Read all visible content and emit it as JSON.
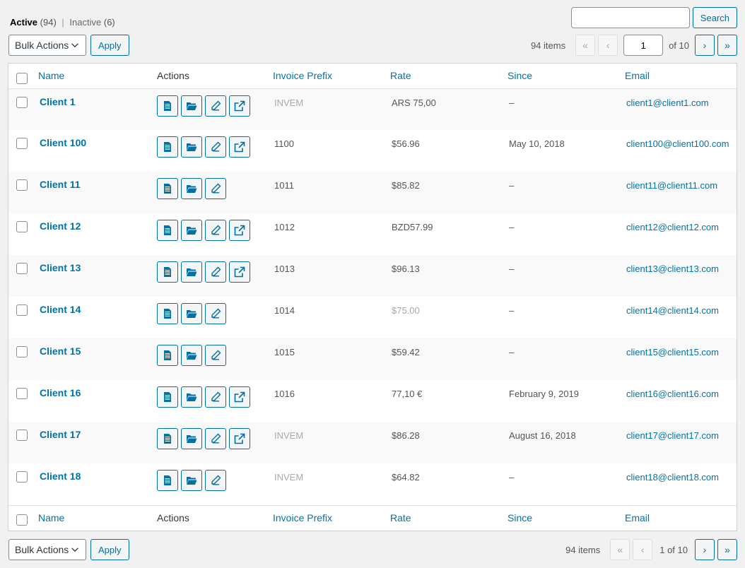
{
  "filters": {
    "active_label": "Active",
    "active_count": "(94)",
    "separator": "|",
    "inactive_label": "Inactive",
    "inactive_count": "(6)"
  },
  "search": {
    "placeholder": "",
    "button": "Search"
  },
  "bulk": {
    "label": "Bulk Actions",
    "apply": "Apply"
  },
  "pagination_top": {
    "items": "94 items",
    "first": "«",
    "prev": "‹",
    "current_page": "1",
    "of_label": "of 10",
    "next": "›",
    "last": "»"
  },
  "pagination_bottom": {
    "items": "94 items",
    "first": "«",
    "prev": "‹",
    "page_text": "1 of 10",
    "next": "›",
    "last": "»"
  },
  "columns": {
    "name": "Name",
    "actions": "Actions",
    "prefix": "Invoice Prefix",
    "rate": "Rate",
    "since": "Since",
    "email": "Email"
  },
  "rows": [
    {
      "name": "Client 1",
      "prefix": "INVEM",
      "prefix_muted": true,
      "rate": "ARS 75,00",
      "rate_muted": false,
      "since": "–",
      "email": "client1@client1.com",
      "external": true
    },
    {
      "name": "Client 100",
      "prefix": "1100",
      "prefix_muted": false,
      "rate": "$56.96",
      "rate_muted": false,
      "since": "May 10, 2018",
      "email": "client100@client100.com",
      "external": true
    },
    {
      "name": "Client 11",
      "prefix": "1011",
      "prefix_muted": false,
      "rate": "$85.82",
      "rate_muted": false,
      "since": "–",
      "email": "client11@client11.com",
      "external": false
    },
    {
      "name": "Client 12",
      "prefix": "1012",
      "prefix_muted": false,
      "rate": "BZD57.99",
      "rate_muted": false,
      "since": "–",
      "email": "client12@client12.com",
      "external": true
    },
    {
      "name": "Client 13",
      "prefix": "1013",
      "prefix_muted": false,
      "rate": "$96.13",
      "rate_muted": false,
      "since": "–",
      "email": "client13@client13.com",
      "external": true
    },
    {
      "name": "Client 14",
      "prefix": "1014",
      "prefix_muted": false,
      "rate": "$75.00",
      "rate_muted": true,
      "since": "–",
      "email": "client14@client14.com",
      "external": false
    },
    {
      "name": "Client 15",
      "prefix": "1015",
      "prefix_muted": false,
      "rate": "$59.42",
      "rate_muted": false,
      "since": "–",
      "email": "client15@client15.com",
      "external": false
    },
    {
      "name": "Client 16",
      "prefix": "1016",
      "prefix_muted": false,
      "rate": "77,10 €",
      "rate_muted": false,
      "since": "February 9, 2019",
      "email": "client16@client16.com",
      "external": true
    },
    {
      "name": "Client 17",
      "prefix": "INVEM",
      "prefix_muted": true,
      "rate": "$86.28",
      "rate_muted": false,
      "since": "August 16, 2018",
      "email": "client17@client17.com",
      "external": true
    },
    {
      "name": "Client 18",
      "prefix": "INVEM",
      "prefix_muted": true,
      "rate": "$64.82",
      "rate_muted": false,
      "since": "–",
      "email": "client18@client18.com",
      "external": false
    }
  ],
  "icons": {
    "row_actions": [
      "invoice-icon",
      "folder-icon",
      "edit-pencil-icon",
      "external-link-icon"
    ],
    "dropdown": "chevron-down-icon"
  },
  "colors": {
    "accent": "#0073aa",
    "button_border": "#0071a1",
    "muted_text": "#aaaaaa"
  }
}
